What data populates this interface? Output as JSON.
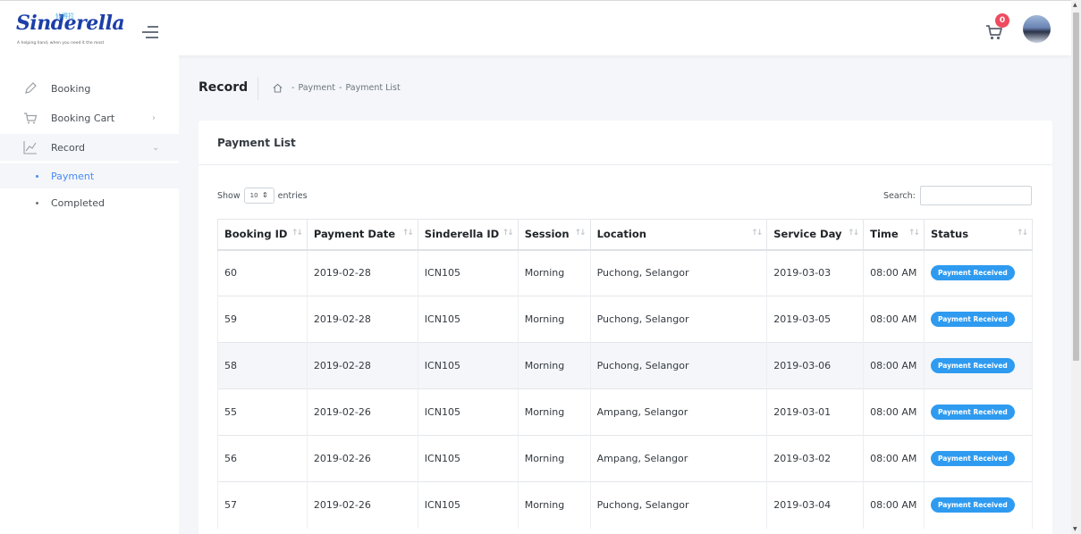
{
  "header": {
    "logo_text": "Sinderella",
    "logo_chinese": "仙得拉",
    "logo_tagline": "A helping hand, when you need it the most",
    "cart_count": "0"
  },
  "sidebar": {
    "items": [
      {
        "label": "Booking",
        "icon": "pen-icon"
      },
      {
        "label": "Booking Cart",
        "icon": "cart-icon",
        "chevron": "›"
      },
      {
        "label": "Record",
        "icon": "chart-icon",
        "chevron": "⌄"
      }
    ],
    "sub_items": [
      {
        "label": "Payment"
      },
      {
        "label": "Completed"
      }
    ]
  },
  "page": {
    "title": "Record",
    "breadcrumb": [
      "Payment",
      "Payment List"
    ],
    "breadcrumb_sep": "-"
  },
  "card": {
    "title": "Payment List",
    "show_label": "Show",
    "entries_value": "10",
    "entries_label": "entries",
    "search_label": "Search:"
  },
  "table": {
    "columns": [
      "Booking ID",
      "Payment Date",
      "Sinderella ID",
      "Session",
      "Location",
      "Service Day",
      "Time",
      "Status"
    ],
    "rows": [
      {
        "booking_id": "60",
        "payment_date": "2019-02-28",
        "sinderella_id": "ICN105",
        "session": "Morning",
        "location": "Puchong, Selangor",
        "service_day": "2019-03-03",
        "time": "08:00 AM",
        "status": "Payment Received"
      },
      {
        "booking_id": "59",
        "payment_date": "2019-02-28",
        "sinderella_id": "ICN105",
        "session": "Morning",
        "location": "Puchong, Selangor",
        "service_day": "2019-03-05",
        "time": "08:00 AM",
        "status": "Payment Received"
      },
      {
        "booking_id": "58",
        "payment_date": "2019-02-28",
        "sinderella_id": "ICN105",
        "session": "Morning",
        "location": "Puchong, Selangor",
        "service_day": "2019-03-06",
        "time": "08:00 AM",
        "status": "Payment Received"
      },
      {
        "booking_id": "55",
        "payment_date": "2019-02-26",
        "sinderella_id": "ICN105",
        "session": "Morning",
        "location": "Ampang, Selangor",
        "service_day": "2019-03-01",
        "time": "08:00 AM",
        "status": "Payment Received"
      },
      {
        "booking_id": "56",
        "payment_date": "2019-02-26",
        "sinderella_id": "ICN105",
        "session": "Morning",
        "location": "Ampang, Selangor",
        "service_day": "2019-03-02",
        "time": "08:00 AM",
        "status": "Payment Received"
      },
      {
        "booking_id": "57",
        "payment_date": "2019-02-26",
        "sinderella_id": "ICN105",
        "session": "Morning",
        "location": "Puchong, Selangor",
        "service_day": "2019-03-04",
        "time": "08:00 AM",
        "status": "Payment Received"
      }
    ]
  },
  "colors": {
    "accent": "#4a8bf4",
    "status_pill": "#2e9bf0",
    "cart_badge": "#ef4b5f",
    "logo_blue": "#1c3fa8"
  }
}
